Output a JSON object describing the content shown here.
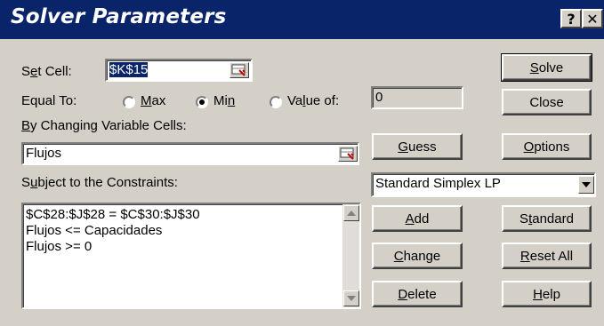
{
  "window": {
    "title": "Solver Parameters",
    "help_glyph": "?",
    "close_glyph": "✕"
  },
  "set_cell": {
    "label_pre": "S",
    "label_u": "e",
    "label_post": "t Cell:",
    "value": "$K$15"
  },
  "equal_to": {
    "label": "Equal To:",
    "options": [
      {
        "pre": "",
        "u": "M",
        "post": "ax",
        "selected": false
      },
      {
        "pre": "Mi",
        "u": "n",
        "post": "",
        "selected": true
      },
      {
        "pre": "Va",
        "u": "l",
        "post": "ue of:",
        "selected": false
      }
    ],
    "value_of": "0"
  },
  "changing_cells": {
    "label_pre": "",
    "label_u": "B",
    "label_post": "y Changing Variable Cells:",
    "value": "Flujos"
  },
  "constraints": {
    "label_pre": "S",
    "label_u": "u",
    "label_post": "bject to the Constraints:",
    "items": [
      "$C$28:$J$28 = $C$30:$J$30",
      "Flujos <= Capacidades",
      "Flujos >= 0"
    ]
  },
  "method": {
    "selected": "Standard Simplex LP"
  },
  "buttons": {
    "solve": {
      "pre": "",
      "u": "S",
      "post": "olve"
    },
    "close": {
      "pre": "Close",
      "u": "",
      "post": ""
    },
    "guess": {
      "pre": "",
      "u": "G",
      "post": "uess"
    },
    "options": {
      "pre": "",
      "u": "O",
      "post": "ptions"
    },
    "add": {
      "pre": "",
      "u": "A",
      "post": "dd"
    },
    "standard": {
      "pre": "S",
      "u": "t",
      "post": "andard"
    },
    "change": {
      "pre": "",
      "u": "C",
      "post": "hange"
    },
    "reset_all": {
      "pre": "",
      "u": "R",
      "post": "eset All"
    },
    "delete": {
      "pre": "",
      "u": "D",
      "post": "elete"
    },
    "help": {
      "pre": "",
      "u": "H",
      "post": "elp"
    }
  },
  "icons": {
    "ref_icon": "range-selector-icon",
    "scroll_up": "scroll-up-arrow-icon",
    "scroll_down": "scroll-down-arrow-icon",
    "dropdown": "dropdown-arrow-icon"
  },
  "colors": {
    "titlebar": "#0a246a",
    "face": "#d4d0c8"
  }
}
